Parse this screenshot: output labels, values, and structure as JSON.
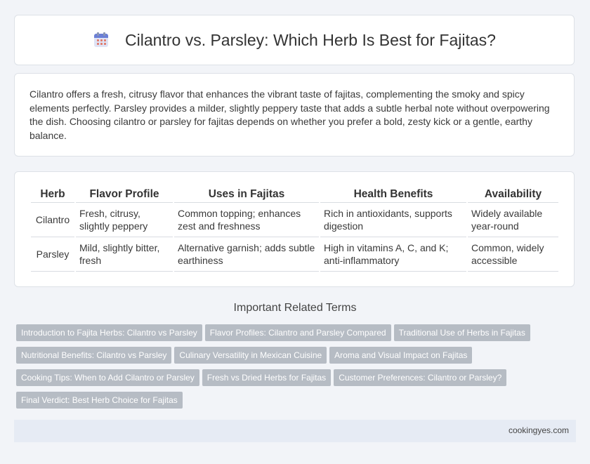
{
  "page": {
    "title": "Cilantro vs. Parsley: Which Herb Is Best for Fajitas?",
    "title_icon": "calendar-icon"
  },
  "intro": {
    "text": "Cilantro offers a fresh, citrusy flavor that enhances the vibrant taste of fajitas, complementing the smoky and spicy elements perfectly. Parsley provides a milder, slightly peppery taste that adds a subtle herbal note without overpowering the dish. Choosing cilantro or parsley for fajitas depends on whether you prefer a bold, zesty kick or a gentle, earthy balance."
  },
  "table": {
    "headers": [
      "Herb",
      "Flavor Profile",
      "Uses in Fajitas",
      "Health Benefits",
      "Availability"
    ],
    "rows": [
      [
        "Cilantro",
        "Fresh, citrusy, slightly peppery",
        "Common topping; enhances zest and freshness",
        "Rich in antioxidants, supports digestion",
        "Widely available year-round"
      ],
      [
        "Parsley",
        "Mild, slightly bitter, fresh",
        "Alternative garnish; adds subtle earthiness",
        "High in vitamins A, C, and K; anti-inflammatory",
        "Common, widely accessible"
      ]
    ]
  },
  "related": {
    "title": "Important Related Terms",
    "tags": [
      "Introduction to Fajita Herbs: Cilantro vs Parsley",
      "Flavor Profiles: Cilantro and Parsley Compared",
      "Traditional Use of Herbs in Fajitas",
      "Nutritional Benefits: Cilantro vs Parsley",
      "Culinary Versatility in Mexican Cuisine",
      "Aroma and Visual Impact on Fajitas",
      "Cooking Tips: When to Add Cilantro or Parsley",
      "Fresh vs Dried Herbs for Fajitas",
      "Customer Preferences: Cilantro or Parsley?",
      "Final Verdict: Best Herb Choice for Fajitas"
    ]
  },
  "footer": {
    "site": "cookingyes.com"
  }
}
